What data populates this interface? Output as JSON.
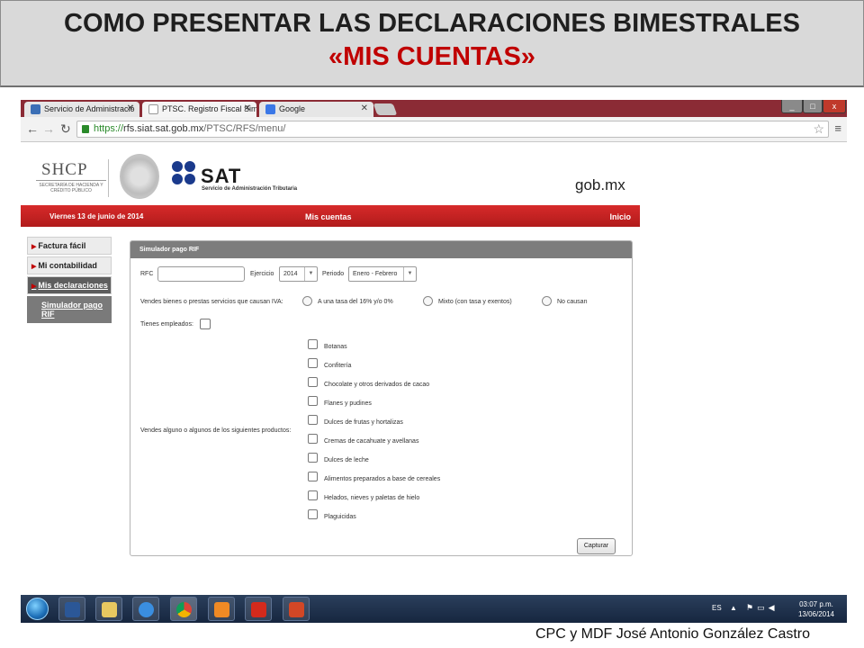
{
  "banner": {
    "line1": "COMO PRESENTAR LAS DECLARACIONES BIMESTRALES",
    "line2": "«MIS CUENTAS»"
  },
  "browser": {
    "tabs": [
      {
        "label": "Servicio de Administració",
        "icon": "sat-favicon"
      },
      {
        "label": "PTSC. Registro Fiscal Sim",
        "icon": "page-icon"
      },
      {
        "label": "Google",
        "icon": "google-icon"
      }
    ],
    "url": {
      "scheme": "https://",
      "host": "rfs.siat.sat.gob.mx",
      "path": "/PTSC/RFS/menu/"
    },
    "window_controls": [
      "_",
      "□",
      "x"
    ],
    "colors": {
      "tabstrip": "#8b2b35",
      "close_button": "#c0392b"
    }
  },
  "page": {
    "shcp": {
      "title": "SHCP",
      "subtitle": "SECRETARÍA DE HACIENDA Y CRÉDITO PÚBLICO"
    },
    "sat": {
      "name": "SAT",
      "subtitle": "Servicio de Administración Tributaria"
    },
    "gob": "gob.mx",
    "redbar": {
      "date": "Viernes 13 de junio de 2014",
      "center": "Mis cuentas",
      "home": "Inicio",
      "color": "#c62323"
    },
    "sidemenu": {
      "items": [
        {
          "label": "Factura fácil"
        },
        {
          "label": "Mi contabilidad"
        },
        {
          "label": "Mis declaraciones"
        }
      ],
      "sub_item": "Simulador pago RIF"
    },
    "simulator": {
      "title": "Simulador pago RIF",
      "rfc_label": "RFC",
      "rfc_value": "",
      "ejercicio_label": "Ejercicio",
      "ejercicio_value": "2014",
      "periodo_label": "Periodo",
      "periodo_value": "Enero - Febrero",
      "iva_question": "Vendes bienes o prestas servicios que causan IVA:",
      "iva_options": [
        "A una tasa del 16% y/o 0%",
        "Mixto (con tasa y exentos)",
        "No causan"
      ],
      "employees_label": "Tienes empleados:",
      "products_question": "Vendes alguno o algunos de los siguientes productos:",
      "products": [
        "Botanas",
        "Confitería",
        "Chocolate y otros derivados de cacao",
        "Flanes y pudines",
        "Dulces de frutas y hortalizas",
        "Cremas de cacahuate y avellanas",
        "Dulces de leche",
        "Alimentos preparados a base de cereales",
        "Helados, nieves y paletas de hielo",
        "Plaguicidas"
      ],
      "submit": "Capturar"
    }
  },
  "taskbar": {
    "apps": [
      "word",
      "file-explorer",
      "internet-explorer",
      "chrome",
      "media-player",
      "acrobat",
      "powerpoint"
    ],
    "language": "ES",
    "time": "03:07 p.m.",
    "date": "13/06/2014"
  },
  "footer": "CPC y MDF José Antonio González Castro"
}
